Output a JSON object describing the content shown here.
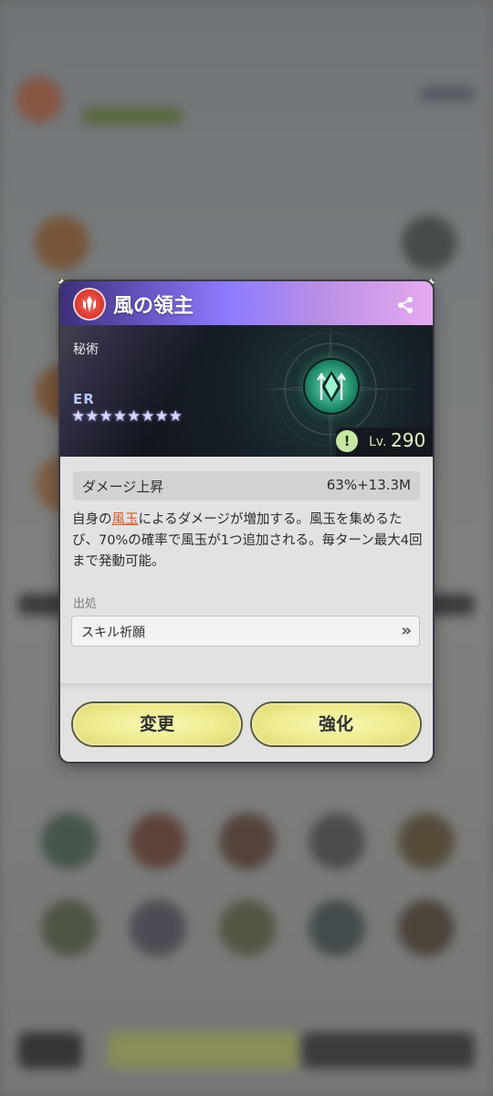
{
  "skill": {
    "name": "風の領主",
    "category": "秘術",
    "rarity": "ER",
    "stars": "★★★★★★★★",
    "level_prefix": "Lv.",
    "level": "290",
    "alert_symbol": "!"
  },
  "stat": {
    "name": "ダメージ上昇",
    "value": "63%+13.3M"
  },
  "description": {
    "before": "自身の",
    "highlight": "風玉",
    "after": "によるダメージが増加する。風玉を集めるたび、70%の確率で風玉が1つ追加される。毎ターン最大4回まで発動可能。"
  },
  "source": {
    "label": "出処",
    "value": "スキル祈願",
    "arrow": "»"
  },
  "buttons": {
    "change": "変更",
    "enhance": "強化"
  },
  "icons": [
    "share-icon",
    "skill-emblem-icon",
    "alert-icon",
    "chevrons-right-icon"
  ],
  "colors": {
    "button": "#eeeb8c",
    "highlight": "#d85a2a",
    "title_gradient_start": "#6a59c8",
    "title_gradient_end": "#e6a9f0"
  }
}
